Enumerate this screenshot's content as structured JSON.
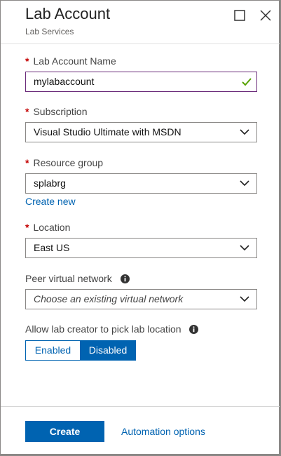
{
  "header": {
    "title": "Lab Account",
    "subtitle": "Lab Services"
  },
  "form": {
    "lab_account_name": {
      "label": "Lab Account Name",
      "required_mark": "*",
      "value": "mylabaccount"
    },
    "subscription": {
      "label": "Subscription",
      "required_mark": "*",
      "value": "Visual Studio Ultimate with MSDN"
    },
    "resource_group": {
      "label": "Resource group",
      "required_mark": "*",
      "value": "splabrg",
      "create_new_link": "Create new"
    },
    "location": {
      "label": "Location",
      "required_mark": "*",
      "value": "East US"
    },
    "peer_virtual_network": {
      "label": "Peer virtual network",
      "placeholder": "Choose an existing virtual network"
    },
    "pick_location": {
      "label": "Allow lab creator to pick lab location",
      "options": [
        "Enabled",
        "Disabled"
      ],
      "selected": "Disabled"
    }
  },
  "footer": {
    "create_label": "Create",
    "automation_label": "Automation options"
  },
  "colors": {
    "accent": "#0063b1",
    "required": "#c40000",
    "valid_check": "#57a300",
    "active_border": "#6b2b7a"
  },
  "icons": {
    "maximize": "maximize-icon",
    "close": "close-icon",
    "dropdown": "chevron-down-icon",
    "info": "info-icon",
    "valid": "checkmark-icon"
  }
}
